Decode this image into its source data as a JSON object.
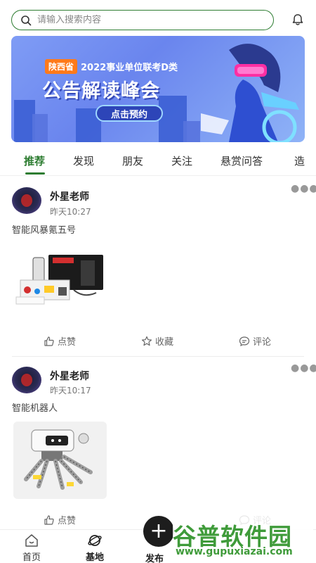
{
  "search": {
    "placeholder": "请输入搜索内容"
  },
  "banner": {
    "tag": "陕西省",
    "subtitle": "2022事业单位联考D类",
    "title": "公告解读峰会",
    "cta": "点击预约"
  },
  "tabs": [
    "推荐",
    "发现",
    "朋友",
    "关注",
    "悬赏问答",
    "造"
  ],
  "active_tab": "推荐",
  "posts": [
    {
      "author": "外星老师",
      "time": "昨天10:27",
      "text": "智能风暴氪五号",
      "actions": {
        "like": "点赞",
        "favorite": "收藏",
        "comment": "评论"
      }
    },
    {
      "author": "外星老师",
      "time": "昨天10:17",
      "text": "智能机器人",
      "actions": {
        "like": "点赞",
        "comment": "评论"
      }
    }
  ],
  "bottom_nav": {
    "home": "首页",
    "base": "基地",
    "publish": "发布"
  },
  "watermark": {
    "logo": "谷普软件园",
    "url": "www.gupuxiazai.com"
  },
  "colors": {
    "accent": "#2e7d32",
    "fab": "#1d1d1d"
  }
}
